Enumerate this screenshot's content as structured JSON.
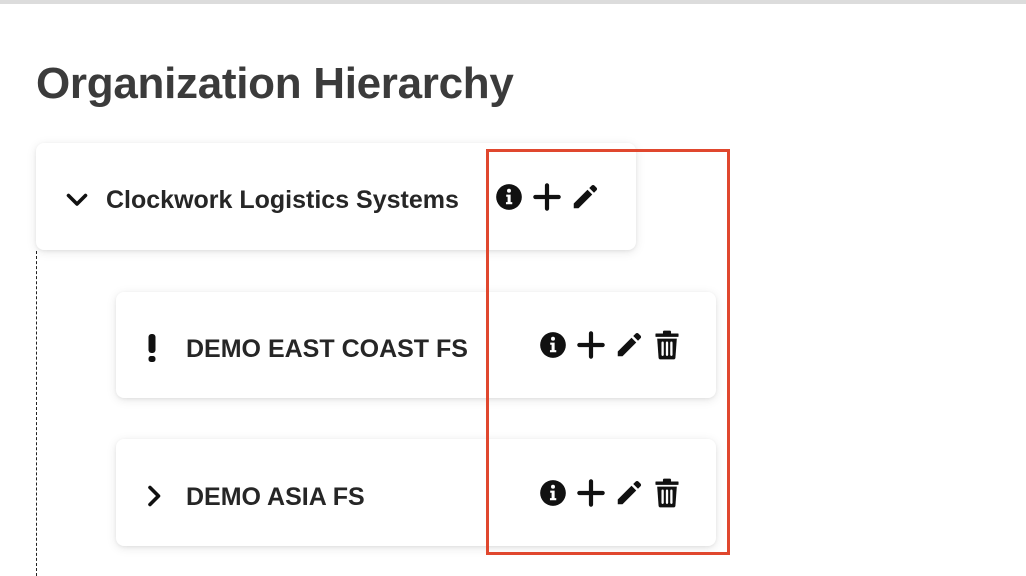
{
  "page": {
    "title": "Organization Hierarchy"
  },
  "colors": {
    "title": "#3b3b3b",
    "text": "#262626",
    "icon": "#111111",
    "highlight": "#e0472e"
  },
  "tree": {
    "root": {
      "label": "Clockwork Logistics Systems",
      "lead_icon": "chevron-down-icon",
      "actions": [
        "info-icon",
        "plus-icon",
        "pencil-icon"
      ]
    },
    "children": [
      {
        "label": "DEMO EAST COAST FS",
        "lead_icon": "exclamation-icon",
        "actions": [
          "info-icon",
          "plus-icon",
          "pencil-icon",
          "trash-icon"
        ]
      },
      {
        "label": "DEMO ASIA FS",
        "lead_icon": "chevron-right-icon",
        "actions": [
          "info-icon",
          "plus-icon",
          "pencil-icon",
          "trash-icon"
        ]
      }
    ]
  }
}
